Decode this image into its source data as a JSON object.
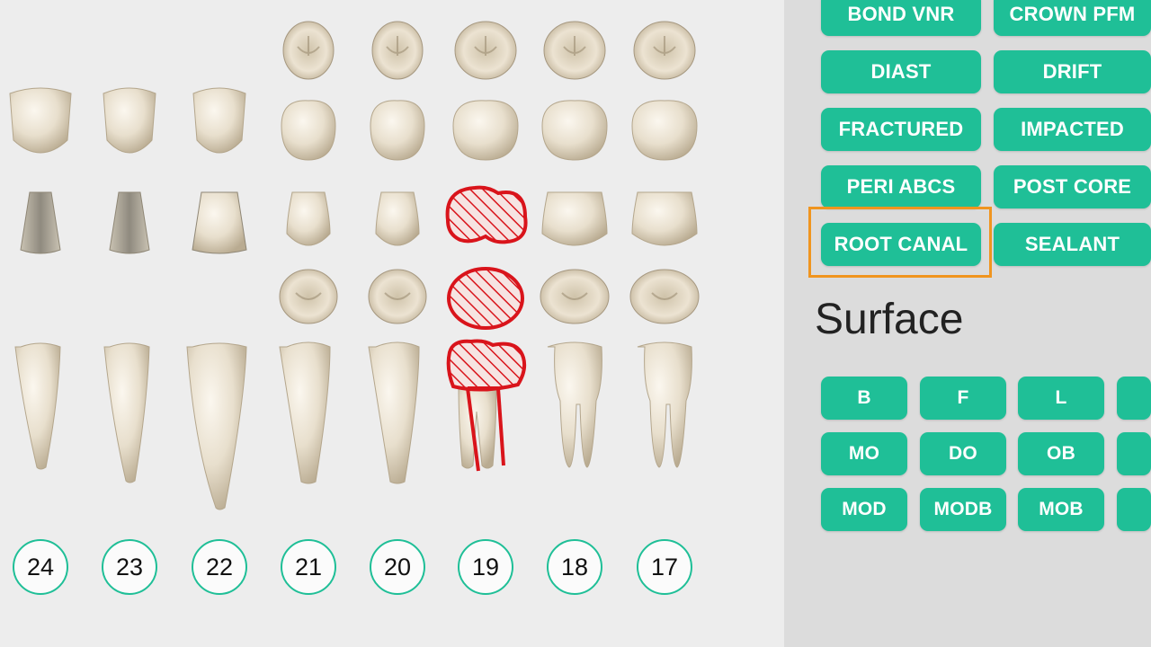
{
  "tooth_numbers": [
    "24",
    "23",
    "22",
    "21",
    "20",
    "19",
    "18",
    "17"
  ],
  "selected_tooth": "19",
  "condition_buttons": [
    [
      "BOND VNR",
      "CROWN PFM"
    ],
    [
      "DIAST",
      "DRIFT"
    ],
    [
      "FRACTURED",
      "IMPACTED"
    ],
    [
      "PERI ABCS",
      "POST CORE"
    ],
    [
      "ROOT CANAL",
      "SEALANT"
    ]
  ],
  "highlighted_condition": "ROOT CANAL",
  "surface": {
    "heading": "Surface",
    "buttons": [
      [
        "B",
        "F",
        "L",
        ""
      ],
      [
        "MO",
        "DO",
        "OB",
        ""
      ],
      [
        "MOD",
        "MODB",
        "MOB",
        ""
      ]
    ]
  },
  "colors": {
    "accent": "#1fbf97",
    "highlight": "#f0951f",
    "marked": "#d9141b",
    "tooth": "#e6dcc8"
  },
  "icons": {
    "tooth_views": "tooth-icon",
    "marking": "hatched-red-marking-icon"
  }
}
